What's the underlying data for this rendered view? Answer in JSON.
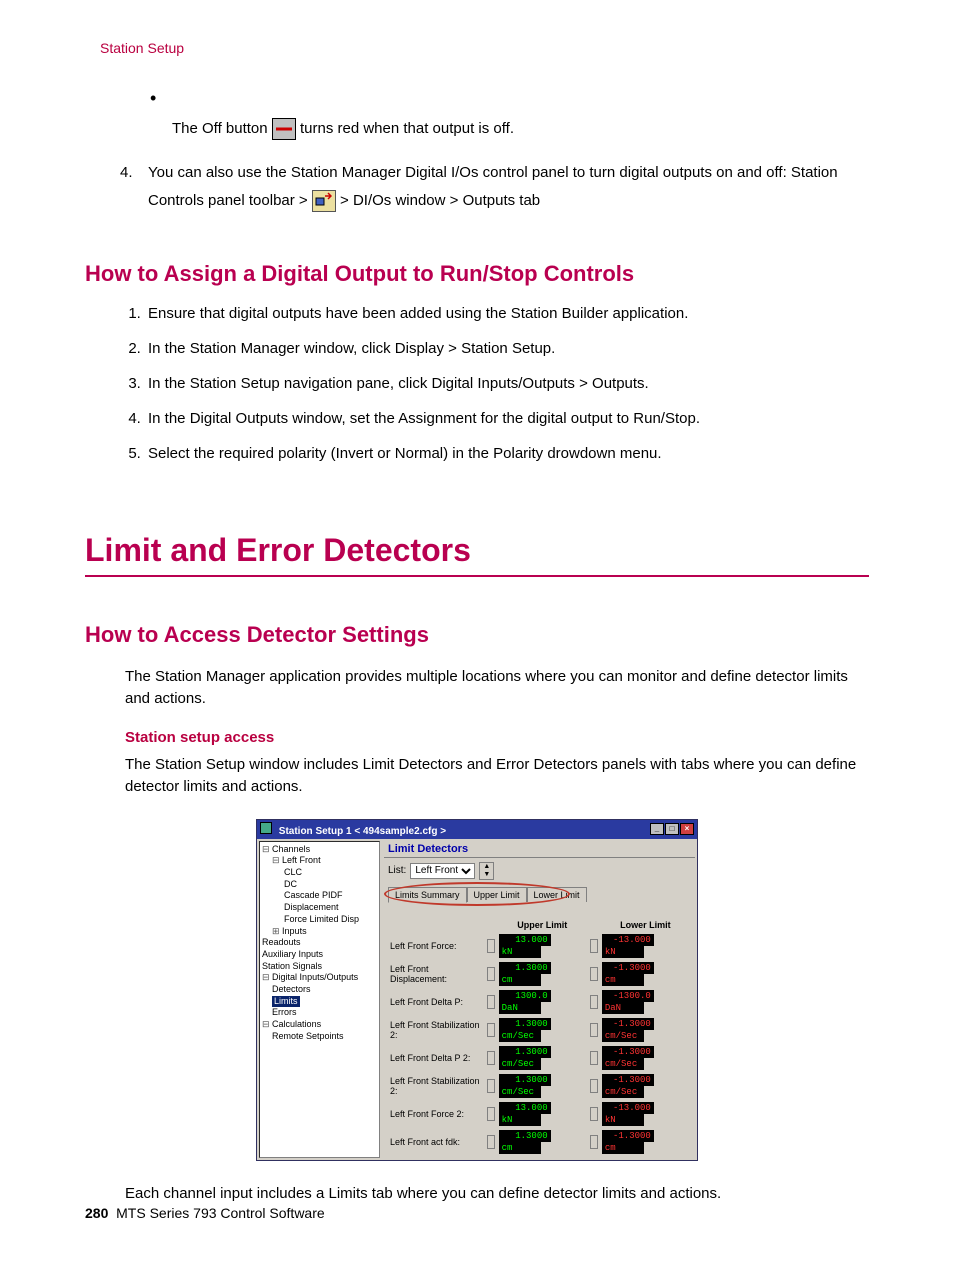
{
  "pageHeader": "Station Setup",
  "bulletText1": "The Off button ",
  "bulletText2": " turns red when that output is off.",
  "step4a": "You can also use the Station Manager Digital I/Os control panel to turn digital outputs on and off: Station Controls panel toolbar > ",
  "step4b": " > DI/Os window > Outputs tab",
  "h2a": "How to Assign a Digital Output to Run/Stop Controls",
  "steps": [
    "Ensure that digital outputs have been added using the Station Builder application.",
    "In the Station Manager window, click Display > Station Setup.",
    "In the Station Setup navigation pane, click Digital Inputs/Outputs > Outputs.",
    "In the Digital Outputs window, set the Assignment for the digital output to Run/Stop.",
    "Select the required polarity (Invert or Normal) in the Polarity drowdown menu."
  ],
  "chapter": "Limit and Error Detectors",
  "h2b": "How to Access Detector Settings",
  "para1": "The Station Manager application provides multiple locations where you can monitor and define detector limits and actions.",
  "subhead": "Station setup access",
  "para2": "The Station Setup window includes Limit Detectors and Error Detectors panels with tabs where you can define detector limits and actions.",
  "para3": "Each channel input includes a Limits tab where you can define detector limits and actions.",
  "footerPage": "280",
  "footerText": "MTS Series 793 Control Software",
  "shot": {
    "title": "Station Setup 1 < 494sample2.cfg >",
    "tree": [
      {
        "cls": "",
        "icon": "⊟",
        "txt": "Channels"
      },
      {
        "cls": "ind1",
        "icon": "⊟",
        "txt": "Left Front"
      },
      {
        "cls": "ind2",
        "icon": "",
        "txt": "CLC"
      },
      {
        "cls": "ind2",
        "icon": "",
        "txt": "DC"
      },
      {
        "cls": "ind2",
        "icon": "",
        "txt": "Cascade PIDF"
      },
      {
        "cls": "ind2",
        "icon": "",
        "txt": "Displacement"
      },
      {
        "cls": "ind2",
        "icon": "",
        "txt": "Force Limited Disp"
      },
      {
        "cls": "ind1",
        "icon": "⊞",
        "txt": "Inputs"
      },
      {
        "cls": "",
        "icon": "",
        "txt": "Readouts"
      },
      {
        "cls": "",
        "icon": "",
        "txt": "Auxiliary Inputs"
      },
      {
        "cls": "",
        "icon": "",
        "txt": "Station Signals"
      },
      {
        "cls": "",
        "icon": "⊟",
        "txt": "Digital Inputs/Outputs"
      },
      {
        "cls": "ind1",
        "icon": "",
        "txt": "Detectors"
      },
      {
        "cls": "ind1 hlrow",
        "icon": "",
        "txt": "Limits"
      },
      {
        "cls": "ind1",
        "icon": "",
        "txt": "Errors"
      },
      {
        "cls": "",
        "icon": "⊟",
        "txt": "Calculations"
      },
      {
        "cls": "ind1",
        "icon": "",
        "txt": "Remote Setpoints"
      }
    ],
    "panelTitle": "Limit Detectors",
    "listLabel": "List:",
    "listValue": "Left Front",
    "tabs": [
      "Limits Summary",
      "Upper Limit",
      "Lower Limit"
    ],
    "colUpper": "Upper Limit",
    "colLower": "Lower Limit",
    "rows": [
      {
        "label": "Left Front Force:",
        "uv": "13.000",
        "uu": "kN",
        "lv": "-13.000",
        "lu": "kN"
      },
      {
        "label": "Left Front Displacement:",
        "uv": "1.3000",
        "uu": "cm",
        "lv": "-1.3000",
        "lu": "cm"
      },
      {
        "label": "Left Front Delta P:",
        "uv": "1300.0",
        "uu": "DaN",
        "lv": "-1300.0",
        "lu": "DaN"
      },
      {
        "label": "Left Front Stabilization 2:",
        "uv": "1.3000",
        "uu": "cm/Sec",
        "lv": "-1.3000",
        "lu": "cm/Sec"
      },
      {
        "label": "Left Front Delta P 2:",
        "uv": "1.3000",
        "uu": "cm/Sec",
        "lv": "-1.3000",
        "lu": "cm/Sec"
      },
      {
        "label": "Left Front Stabilization 2:",
        "uv": "1.3000",
        "uu": "cm/Sec",
        "lv": "-1.3000",
        "lu": "cm/Sec"
      },
      {
        "label": "Left Front Force 2:",
        "uv": "13.000",
        "uu": "kN",
        "lv": "-13.000",
        "lu": "kN"
      },
      {
        "label": "Left Front act fdk:",
        "uv": "1.3000",
        "uu": "cm",
        "lv": "-1.3000",
        "lu": "cm"
      }
    ]
  }
}
